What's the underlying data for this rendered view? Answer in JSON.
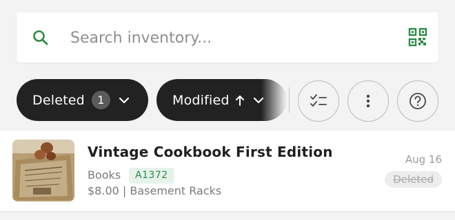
{
  "search": {
    "placeholder": "Search inventory...",
    "icon": "search-icon",
    "scan_icon": "qr-scan-icon"
  },
  "filters": {
    "status_filter": {
      "label": "Deleted",
      "count": "1",
      "icon": "chevron-down-icon"
    },
    "sort": {
      "label": "Modified",
      "direction_icon": "arrow-up-icon",
      "icon": "chevron-down-icon"
    },
    "actions": [
      "checklist-icon",
      "more-vertical-icon",
      "help-icon"
    ]
  },
  "items": [
    {
      "name": "Vintage Cookbook First Edition",
      "category": "Books",
      "sku": "A1372",
      "meta": "$8.00 | Basement Racks",
      "date": "Aug 16",
      "status": "Deleted"
    }
  ],
  "colors": {
    "accent": "#2c8a44",
    "chip_bg": "#222222",
    "sku_bg": "#e6f3ea"
  }
}
